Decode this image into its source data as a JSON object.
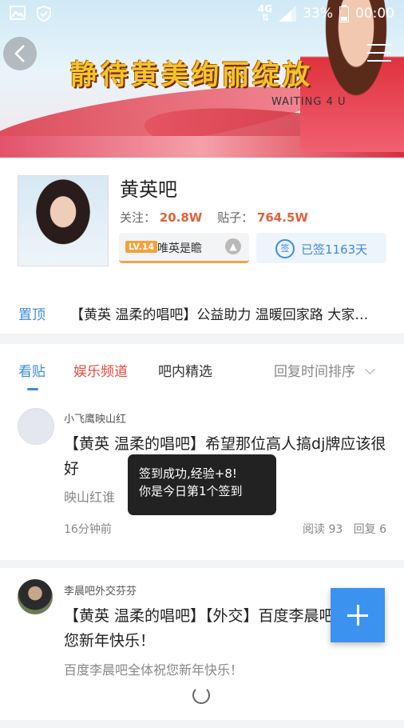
{
  "status_bar": {
    "network": "4G",
    "battery": "33%",
    "time": "00:00",
    "icons": [
      "image-icon",
      "shield-icon",
      "signal-icon",
      "battery-icon"
    ]
  },
  "banner": {
    "title": "静待黄美绚丽绽放",
    "subtitle": "WAITING 4 U"
  },
  "forum": {
    "name": "黄英吧",
    "followers_label": "关注：",
    "followers_value": "20.8W",
    "posts_label": "贴子：",
    "posts_value": "764.5W",
    "level_badge": "LV.14",
    "level_name": "唯英是瞻",
    "signed_label": "已签1163天",
    "sign_icon_text": "签"
  },
  "pinned": {
    "tag": "置顶",
    "text": "【黄英 温柔的唱吧】公益助力 温暖回家路 大家…"
  },
  "tabs": {
    "posts": "看贴",
    "entertainment": "娱乐频道",
    "featured": "吧内精选",
    "sort": "回复时间排序"
  },
  "feed": [
    {
      "author": "小飞鹰映山红",
      "title": "【黄英 温柔的唱吧】希望那位高人搞dj牌应该很好",
      "excerpt": "映山红谁",
      "time": "16分钟前",
      "reads": "阅读 93",
      "replies": "回复 6"
    },
    {
      "author": "李晨吧外交芬芬",
      "title": "【黄英 温柔的唱吧】【外交】百度李晨吧全体祝您新年快乐！",
      "excerpt": "百度李晨吧全体祝您新年快乐！"
    }
  ],
  "toast": {
    "line1": "签到成功,经验+8!",
    "line2": "你是今日第1个签到"
  },
  "colors": {
    "accent": "#3e8be0",
    "count": "#e1623c",
    "entertainment_tab": "#e8483c",
    "fab": "#3b93ef"
  }
}
